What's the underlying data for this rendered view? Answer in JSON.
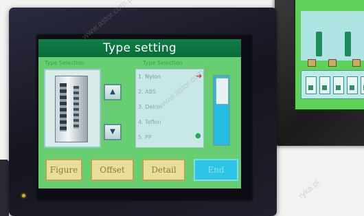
{
  "screen": {
    "title": "Type setting",
    "header_left": "Type Selection",
    "header_right": "Type Selection"
  },
  "list": {
    "items": [
      "1. Nylon",
      "2. ABS",
      "3. Delrin",
      "4. Teflon",
      "5. PP"
    ]
  },
  "buttons": {
    "figure": "Figure",
    "offset": "Offset",
    "detail": "Detail",
    "end": "End"
  },
  "watermark": {
    "text": "www.astor.com.pl",
    "text2": "ryka.pl"
  },
  "colors": {
    "screen_bg": "#67cf71",
    "title_bar": "#0e7f47",
    "button": "#e9df9b",
    "button_active": "#2ec4e8"
  }
}
